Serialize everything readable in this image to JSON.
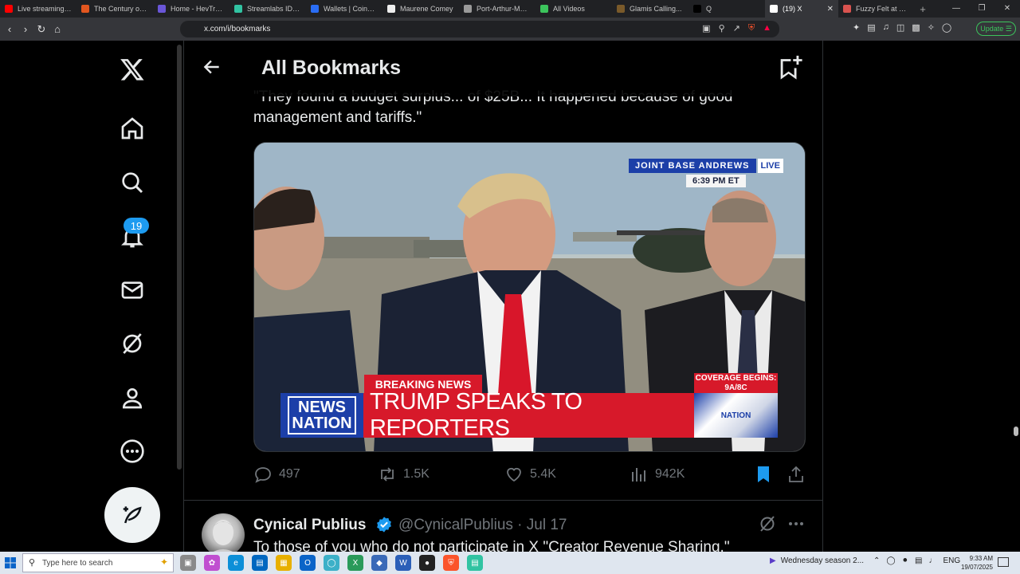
{
  "browser": {
    "tabs": [
      {
        "label": "Live streaming - Y",
        "color": "#ff0000"
      },
      {
        "label": "The Century of Ec",
        "color": "#e2561f"
      },
      {
        "label": "Home - HevTruth",
        "color": "#6a56d8"
      },
      {
        "label": "Streamlabs ID - C",
        "color": "#31c3a2"
      },
      {
        "label": "Wallets | CoinSpc",
        "color": "#2a6df4"
      },
      {
        "label": "Maurene Comey",
        "color": "#eeeeee"
      },
      {
        "label": "Port-Arthur-Mass",
        "color": "#9a9a9a"
      },
      {
        "label": "All Videos",
        "color": "#3cc45c"
      },
      {
        "label": "Glamis Calling...",
        "color": "#7a5a2a"
      },
      {
        "label": "Q",
        "color": "#000000"
      }
    ],
    "active_tab": {
      "label": "(19) X",
      "close": "✕"
    },
    "last_tab": {
      "label": "Fuzzy Felt at Duc",
      "color": "#d9534f"
    },
    "new_tab": "+",
    "window_controls": [
      "—",
      "❐",
      "✕"
    ],
    "url": "x.com/i/bookmarks",
    "update_label": "Update ☰"
  },
  "header": {
    "title": "All Bookmarks"
  },
  "nav": {
    "notifications_count": "19"
  },
  "tweet": {
    "text": "\"They found a budget surplus... of $25B... It happened because of good management and tariffs.\"",
    "media": {
      "location": "JOINT BASE ANDREWS",
      "live": "LIVE",
      "time": "6:39 PM ET",
      "breaking": "BREAKING NEWS",
      "headline": "TRUMP SPEAKS TO REPORTERS",
      "network_line1": "NEWS",
      "network_line2": "NATION",
      "coverage_line1": "COVERAGE BEGINS:",
      "coverage_line2": "9A/8C",
      "nation_badge": "NATION"
    },
    "replies": "497",
    "reposts": "1.5K",
    "likes": "5.4K",
    "views": "942K"
  },
  "tweet2": {
    "name": "Cynical Publius",
    "handle": "@CynicalPublius · Jul 17",
    "text": "To those of you who do not participate in X \"Creator Revenue Sharing,\""
  },
  "taskbar": {
    "search_placeholder": "Type here to search",
    "video_title": "Wednesday season 2...",
    "lang": "ENG",
    "time": "9:33 AM",
    "date": "19/07/2025"
  },
  "colors": {
    "accent": "#1d9bf0",
    "breaking_red": "#d7192a",
    "badge_blue": "#1d9bf0"
  }
}
